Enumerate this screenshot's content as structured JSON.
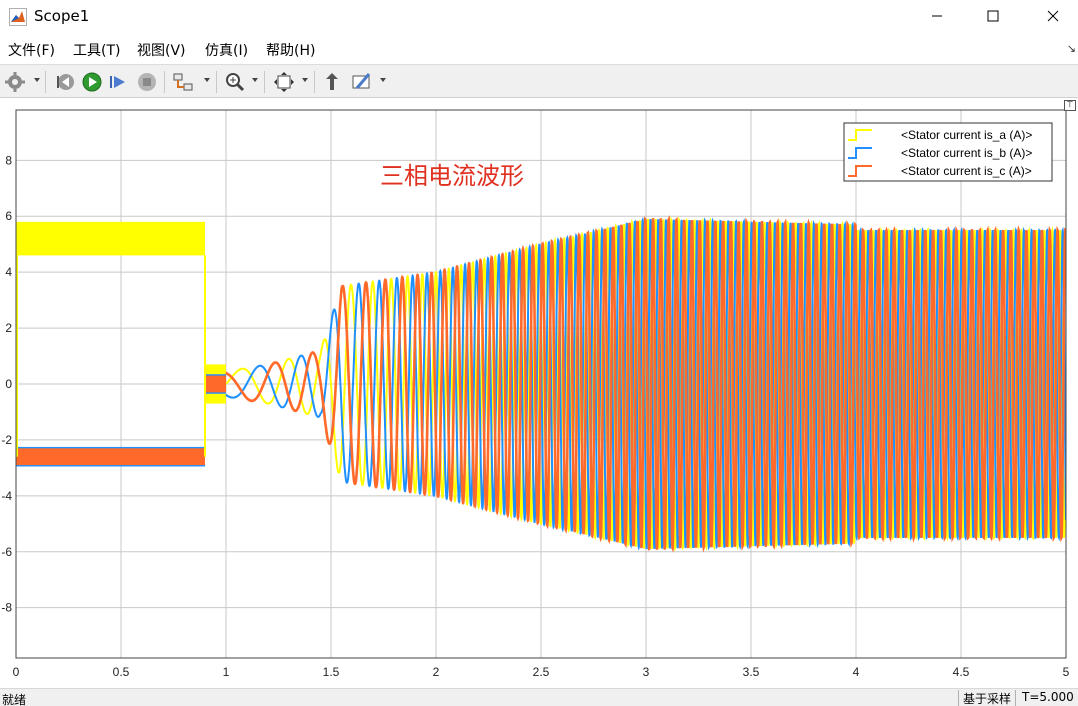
{
  "window": {
    "title": "Scope1"
  },
  "menu": [
    "文件(F)",
    "工具(T)",
    "视图(V)",
    "仿真(I)",
    "帮助(H)"
  ],
  "toolbar": {
    "icons": [
      "gear-icon",
      "step-back-icon",
      "run-icon",
      "step-forward-icon",
      "stop-icon",
      "layout-icon",
      "zoom-icon",
      "fit-to-view-icon",
      "highlight-block-icon",
      "style-icon"
    ]
  },
  "annotation": "三相电流波形",
  "colors": {
    "phase_a": "#ffff00",
    "phase_b": "#1e90ff",
    "phase_c": "#ff6a2a",
    "annotation": "#e03020",
    "grid": "#c8c8c8"
  },
  "chart_data": {
    "type": "line",
    "title": "",
    "xlabel": "",
    "ylabel": "",
    "xlim": [
      0,
      5
    ],
    "ylim": [
      -9.8,
      9.8
    ],
    "grid": true,
    "legend_position": "top-right",
    "xticks": [
      "0",
      "0.5",
      "1",
      "1.5",
      "2",
      "2.5",
      "3",
      "3.5",
      "4",
      "4.5",
      "5"
    ],
    "yticks": [
      "8",
      "6",
      "4",
      "2",
      "0",
      "-2",
      "-4",
      "-6",
      "-8"
    ],
    "series": [
      {
        "name": "<Stator current is_a (A)>",
        "envelope_t": [
          0,
          0.9,
          0.9,
          1.5,
          1.6,
          2.0,
          2.5,
          3.0,
          4.0,
          4.0,
          5.0
        ],
        "segments": [
          {
            "t0": 0.0,
            "t1": 0.9,
            "kind": "dc_band",
            "center": 5.2,
            "ripple": 0.6
          },
          {
            "t0": 0.9,
            "t1": 1.0,
            "kind": "dc_band",
            "center": 0.0,
            "ripple": 0.7
          },
          {
            "t0": 1.0,
            "t1": 5.0,
            "kind": "ac"
          }
        ]
      },
      {
        "name": "<Stator current is_b (A)>",
        "segments": [
          {
            "t0": 0.0,
            "t1": 0.9,
            "kind": "dc_band",
            "center": -2.6,
            "ripple": 0.35
          },
          {
            "t0": 0.9,
            "t1": 1.0,
            "kind": "dc_band",
            "center": 0.0,
            "ripple": 0.35
          },
          {
            "t0": 1.0,
            "t1": 5.0,
            "kind": "ac"
          }
        ]
      },
      {
        "name": "<Stator current is_c (A)>",
        "segments": [
          {
            "t0": 0.0,
            "t1": 0.9,
            "kind": "dc_band",
            "center": -2.6,
            "ripple": 0.3
          },
          {
            "t0": 0.9,
            "t1": 1.0,
            "kind": "dc_band",
            "center": 0.0,
            "ripple": 0.3
          },
          {
            "t0": 1.0,
            "t1": 5.0,
            "kind": "ac"
          }
        ]
      }
    ],
    "ac_amplitude": {
      "t": [
        1.0,
        1.2,
        1.45,
        1.55,
        2.0,
        2.5,
        3.0,
        4.0,
        4.0,
        5.0
      ],
      "a": [
        0.45,
        0.7,
        1.2,
        3.5,
        4.0,
        5.0,
        5.9,
        5.7,
        5.5,
        5.5
      ]
    },
    "ac_frequency_hz": {
      "t": [
        1.0,
        1.5,
        2.0,
        2.5,
        3.0,
        5.0
      ],
      "f": [
        3,
        7,
        16,
        22,
        27,
        27
      ]
    }
  },
  "status": {
    "left": "就绪",
    "mode": "基于采样",
    "time": "T=5.000"
  }
}
